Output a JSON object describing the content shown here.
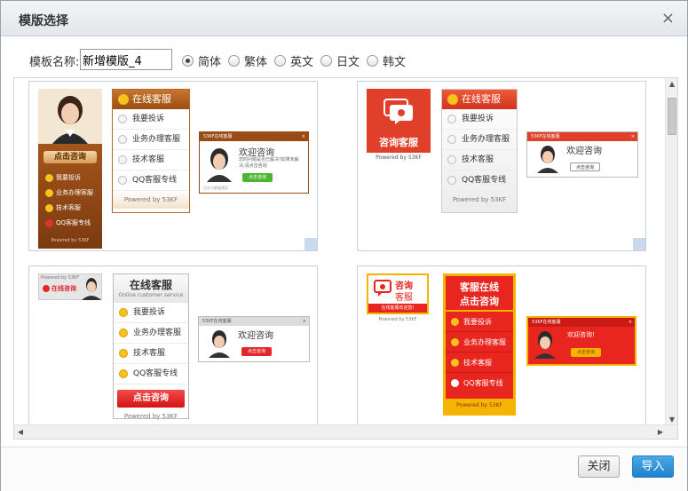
{
  "dialog": {
    "title": "模版选择",
    "close_glyph": "×"
  },
  "toolbar": {
    "name_label": "模板名称:",
    "name_value": "新增模版_4",
    "languages": [
      {
        "label": "简体",
        "checked": true
      },
      {
        "label": "繁体",
        "checked": false
      },
      {
        "label": "英文",
        "checked": false
      },
      {
        "label": "日文",
        "checked": false
      },
      {
        "label": "韩文",
        "checked": false
      }
    ]
  },
  "templates": {
    "t1": {
      "side_btn": "点击咨询",
      "side_items": [
        "我要投诉",
        "业务办理客服",
        "技术客服",
        "QQ客服专线"
      ],
      "side_foot": "Powered by 53KF",
      "panel_title": "在线客服",
      "panel_items": [
        "我要投诉",
        "业务办理客服",
        "技术客服",
        "QQ客服专线"
      ],
      "panel_foot": "Powered by 53KF",
      "invite_bar": "53KF在线客服",
      "invite_title": "欢迎咨询",
      "invite_text": "您的问题是否已解决?如果未解决,请点击咨询",
      "invite_btn": "点击咨询",
      "invite_foot": "正在与客服通话",
      "colors": {
        "wood": "#a4551c",
        "wood_dark": "#7b3a10",
        "green": "#4cb52f"
      }
    },
    "t2": {
      "tile_title": "咨询客服",
      "tile_foot": "Powered by 53KF",
      "panel_title": "在线客服",
      "panel_items": [
        "我要投诉",
        "业务办理客服",
        "技术客服",
        "QQ客服专线"
      ],
      "panel_foot": "Powered by 53KF",
      "invite_bar": "53KF在线客服",
      "invite_title": "欢迎咨询",
      "invite_btn": "点击咨询",
      "colors": {
        "red": "#e0402a"
      }
    },
    "t3": {
      "mini_top": "Powered by 53KF",
      "mini_label": "在线咨询",
      "panel_title": "在线客服",
      "panel_sub": "Online customer service",
      "panel_items": [
        "我要投诉",
        "业务办理客服",
        "技术客服",
        "QQ客服专线"
      ],
      "panel_btn": "点击咨询",
      "panel_foot": "Powered by 53KF",
      "invite_bar": "53KF在线客服",
      "invite_title": "欢迎咨询",
      "invite_btn": "点击咨询",
      "colors": {
        "red": "#e2262a",
        "gray": "#e6e6e6"
      }
    },
    "t4": {
      "badge_top": "咨询",
      "badge_bottom": "客服",
      "badge_link": "在线客服欢迎您!",
      "badge_foot": "Powered by 53KF",
      "panel_title_1": "客服在线",
      "panel_title_2": "点击咨询",
      "panel_items": [
        "我要投诉",
        "业务办理客服",
        "技术客服",
        "QQ客服专线"
      ],
      "panel_foot": "Powered by 53KF",
      "invite_bar": "53KF在线客服",
      "invite_title": "欢迎咨询!",
      "invite_btn": "点击咨询",
      "colors": {
        "red": "#e9251f",
        "gold": "#f5b400"
      }
    }
  },
  "footer": {
    "close_label": "关闭",
    "import_label": "导入"
  }
}
